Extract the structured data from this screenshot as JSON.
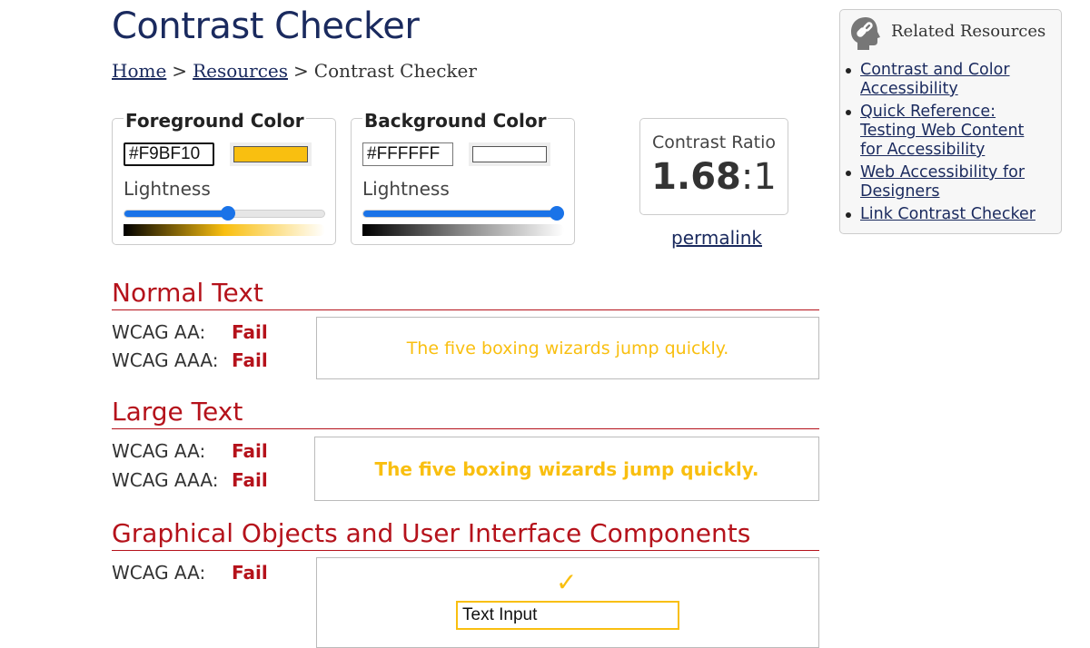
{
  "page": {
    "title": "Contrast Checker"
  },
  "breadcrumb": {
    "home": "Home",
    "resources": "Resources",
    "separator": ">",
    "current": "Contrast Checker"
  },
  "foreground": {
    "legend": "Foreground Color",
    "hex": "#F9BF10",
    "swatch_color": "#F9BF10",
    "lightness_label": "Lightness",
    "lightness_percent": 52
  },
  "background": {
    "legend": "Background Color",
    "hex": "#FFFFFF",
    "swatch_color": "#FFFFFF",
    "lightness_label": "Lightness",
    "lightness_percent": 97
  },
  "contrast": {
    "label": "Contrast Ratio",
    "ratio_main": "1.68",
    "ratio_suffix": ":1",
    "permalink": "permalink"
  },
  "colors": {
    "accent_red": "#B5121B",
    "link_navy": "#1A2A5E",
    "slider_blue": "#1A73E8"
  },
  "sections": {
    "normal": {
      "heading": "Normal Text",
      "aa_label": "WCAG AA:",
      "aa_result": "Fail",
      "aaa_label": "WCAG AAA:",
      "aaa_result": "Fail",
      "sample": "The five boxing wizards jump quickly."
    },
    "large": {
      "heading": "Large Text",
      "aa_label": "WCAG AA:",
      "aa_result": "Fail",
      "aaa_label": "WCAG AAA:",
      "aaa_result": "Fail",
      "sample": "The five boxing wizards jump quickly."
    },
    "graphical": {
      "heading": "Graphical Objects and User Interface Components",
      "aa_label": "WCAG AA:",
      "aa_result": "Fail",
      "checkmark": "✓",
      "input_value": "Text Input"
    }
  },
  "related": {
    "icon": "link-head-icon",
    "title": "Related Resources",
    "items": [
      {
        "label": "Contrast and Color Accessibility"
      },
      {
        "label": "Quick Reference: Testing Web Content for Accessibility"
      },
      {
        "label": "Web Accessibility for Designers"
      },
      {
        "label": "Link Contrast Checker"
      }
    ]
  }
}
